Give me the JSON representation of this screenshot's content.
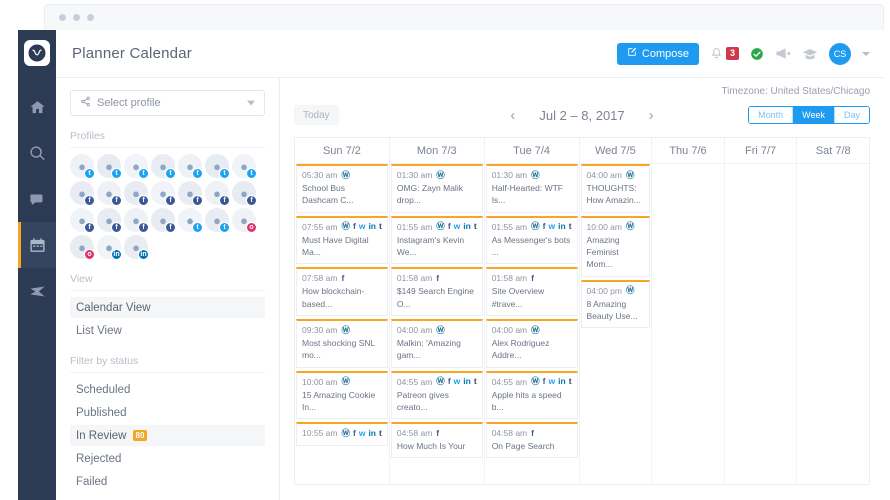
{
  "window": {
    "dots": 3
  },
  "rail": {
    "logo": "circle-logo",
    "items": [
      {
        "name": "home-icon",
        "label": "Home",
        "active": false
      },
      {
        "name": "search-icon",
        "label": "Search",
        "active": false
      },
      {
        "name": "message-icon",
        "label": "Messages",
        "active": false
      },
      {
        "name": "calendar-icon",
        "label": "Calendar",
        "active": true
      },
      {
        "name": "send-icon",
        "label": "Publish",
        "active": false
      }
    ]
  },
  "header": {
    "title": "Planner Calendar",
    "compose_label": "Compose",
    "notification_count": "3",
    "icons": [
      "bell-icon",
      "check-circle-icon",
      "megaphone-icon",
      "graduation-cap-icon"
    ],
    "avatar_initials": "CS"
  },
  "sidebar": {
    "select_profile_label": "Select profile",
    "profiles_label": "Profiles",
    "profiles": [
      {
        "network": "tw"
      },
      {
        "network": "tw"
      },
      {
        "network": "tw"
      },
      {
        "network": "tw"
      },
      {
        "network": "tw"
      },
      {
        "network": "tw"
      },
      {
        "network": "tw"
      },
      {
        "network": "fb"
      },
      {
        "network": "fb"
      },
      {
        "network": "fb"
      },
      {
        "network": "fb"
      },
      {
        "network": "fb"
      },
      {
        "network": "fb"
      },
      {
        "network": "fb"
      },
      {
        "network": "fb"
      },
      {
        "network": "fb"
      },
      {
        "network": "fb"
      },
      {
        "network": "fb"
      },
      {
        "network": "tw"
      },
      {
        "network": "tw"
      },
      {
        "network": "ig"
      },
      {
        "network": "ig"
      },
      {
        "network": "li"
      },
      {
        "network": "li"
      }
    ],
    "view_label": "View",
    "view_items": [
      {
        "label": "Calendar View",
        "active": true
      },
      {
        "label": "List View",
        "active": false
      }
    ],
    "filter_label": "Filter by status",
    "status_items": [
      {
        "label": "Scheduled",
        "active": false,
        "badge": ""
      },
      {
        "label": "Published",
        "active": false,
        "badge": ""
      },
      {
        "label": "In Review",
        "active": true,
        "badge": "80"
      },
      {
        "label": "Rejected",
        "active": false,
        "badge": ""
      },
      {
        "label": "Failed",
        "active": false,
        "badge": ""
      }
    ]
  },
  "calendar": {
    "timezone": "Timezone: United States/Chicago",
    "today_label": "Today",
    "prev_label": "‹",
    "next_label": "›",
    "range": "Jul 2 – 8, 2017",
    "view_modes": [
      {
        "label": "Month",
        "active": false
      },
      {
        "label": "Week",
        "active": true
      },
      {
        "label": "Day",
        "active": false
      }
    ],
    "columns": [
      {
        "header": "Sun 7/2",
        "events": [
          {
            "time": "05:30 am",
            "networks": [
              "wp"
            ],
            "title": "School Bus Dashcam C..."
          },
          {
            "time": "07:55 am",
            "networks": [
              "wp",
              "fb",
              "tw",
              "li",
              "tu"
            ],
            "title": "Must Have Digital Ma..."
          },
          {
            "time": "07:58 am",
            "networks": [
              "fb"
            ],
            "title": "How blockchain-based..."
          },
          {
            "time": "09:30 am",
            "networks": [
              "wp"
            ],
            "title": "Most shocking SNL mo..."
          },
          {
            "time": "10:00 am",
            "networks": [
              "wp"
            ],
            "title": "15 Amazing Cookie In..."
          },
          {
            "time": "10:55 am",
            "networks": [
              "wp",
              "fb",
              "tw",
              "li",
              "tu"
            ],
            "title": ""
          }
        ]
      },
      {
        "header": "Mon 7/3",
        "events": [
          {
            "time": "01:30 am",
            "networks": [
              "wp"
            ],
            "title": "OMG: Zayn Malik drop..."
          },
          {
            "time": "01:55 am",
            "networks": [
              "wp",
              "fb",
              "tw",
              "li",
              "tu"
            ],
            "title": "Instagram's Kevin We..."
          },
          {
            "time": "01:58 am",
            "networks": [
              "fb"
            ],
            "title": "$149 Search Engine O..."
          },
          {
            "time": "04:00 am",
            "networks": [
              "wp"
            ],
            "title": "Malkin: 'Amazing gam..."
          },
          {
            "time": "04:55 am",
            "networks": [
              "wp",
              "fb",
              "tw",
              "li",
              "tu"
            ],
            "title": "Patreon gives creato..."
          },
          {
            "time": "04:58 am",
            "networks": [
              "fb"
            ],
            "title": "How Much Is Your"
          }
        ]
      },
      {
        "header": "Tue 7/4",
        "events": [
          {
            "time": "01:30 am",
            "networks": [
              "wp"
            ],
            "title": "Half-Hearted: WTF Is..."
          },
          {
            "time": "01:55 am",
            "networks": [
              "wp",
              "fb",
              "tw",
              "li",
              "tu"
            ],
            "title": "As Messenger's bots ..."
          },
          {
            "time": "01:58 am",
            "networks": [
              "fb"
            ],
            "title": "Site Overview #trave..."
          },
          {
            "time": "04:00 am",
            "networks": [
              "wp"
            ],
            "title": "Alex Rodriguez Addre..."
          },
          {
            "time": "04:55 am",
            "networks": [
              "wp",
              "fb",
              "tw",
              "li",
              "tu"
            ],
            "title": "Apple hits a speed b..."
          },
          {
            "time": "04:58 am",
            "networks": [
              "fb"
            ],
            "title": "On Page Search"
          }
        ]
      },
      {
        "header": "Wed 7/5",
        "events": [
          {
            "time": "04:00 am",
            "networks": [
              "wp"
            ],
            "title": "THOUGHTS: How Amazin..."
          },
          {
            "time": "10:00 am",
            "networks": [
              "wp"
            ],
            "title": "Amazing Feminist Mom..."
          },
          {
            "time": "04:00 pm",
            "networks": [
              "wp"
            ],
            "title": "8 Amazing Beauty Use..."
          }
        ]
      },
      {
        "header": "Thu 7/6",
        "events": []
      },
      {
        "header": "Fri 7/7",
        "events": []
      },
      {
        "header": "Sat 7/8",
        "events": []
      }
    ]
  }
}
